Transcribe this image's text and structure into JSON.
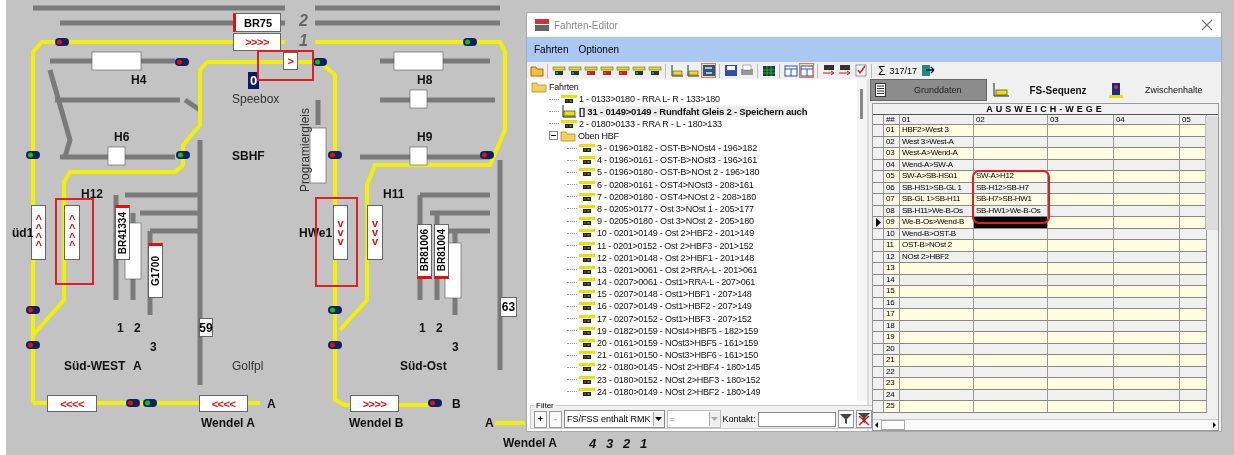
{
  "layout": {
    "labels": [
      {
        "kind": "track_number",
        "text": "2"
      },
      {
        "kind": "track_number",
        "text": "1"
      },
      {
        "kind": "name",
        "text": "H4"
      },
      {
        "kind": "station_box",
        "text": "0"
      },
      {
        "kind": "name",
        "text": "H8"
      },
      {
        "kind": "plain",
        "text": "Speebox"
      },
      {
        "kind": "vertical",
        "text": "Programiergleis"
      },
      {
        "kind": "name",
        "text": "H6"
      },
      {
        "kind": "name",
        "text": "H9"
      },
      {
        "kind": "name",
        "text": "SBHF"
      },
      {
        "kind": "name",
        "text": "H12"
      },
      {
        "kind": "name",
        "text": "H11"
      },
      {
        "kind": "name",
        "text": "üd1"
      },
      {
        "kind": "name",
        "text": "HWe1"
      },
      {
        "kind": "name",
        "text": "1"
      },
      {
        "kind": "name",
        "text": "2"
      },
      {
        "kind": "name",
        "text": "1"
      },
      {
        "kind": "name",
        "text": "2"
      },
      {
        "kind": "name",
        "text": "3"
      },
      {
        "kind": "name",
        "text": "3"
      },
      {
        "kind": "name",
        "text": "Süd-WEST"
      },
      {
        "kind": "name",
        "text": "A"
      },
      {
        "kind": "plain",
        "text": "Golfpl"
      },
      {
        "kind": "name",
        "text": "Süd-Ost"
      },
      {
        "kind": "name",
        "text": "A"
      },
      {
        "kind": "name",
        "text": "B"
      },
      {
        "kind": "name",
        "text": "Wendel  A"
      },
      {
        "kind": "name",
        "text": "Wendel B"
      },
      {
        "kind": "name",
        "text": "A"
      },
      {
        "kind": "name",
        "text": "Wendel A"
      },
      {
        "kind": "italic",
        "text": "4"
      },
      {
        "kind": "italic",
        "text": "3"
      },
      {
        "kind": "italic",
        "text": "2"
      },
      {
        "kind": "italic",
        "text": "1"
      }
    ],
    "blocks": [
      {
        "kind": "train",
        "text": "BR75",
        "edge_left": true
      },
      {
        "kind": "arrows",
        "text": ">>>>"
      },
      {
        "kind": "arrows",
        "text": ">"
      },
      {
        "kind": "arrows_vertical",
        "text": "^^^^"
      },
      {
        "kind": "arrows_vertical",
        "text": "^^^^"
      },
      {
        "kind": "train_vertical",
        "text": "BR41334",
        "edge_top": true
      },
      {
        "kind": "train_vertical",
        "text": "G1700",
        "edge_top": true
      },
      {
        "kind": "arrows_vertical",
        "text": "vvv"
      },
      {
        "kind": "arrows_vertical",
        "text": "vvv"
      },
      {
        "kind": "train_vertical",
        "text": "BR81006",
        "edge_bottom": true
      },
      {
        "kind": "train_vertical",
        "text": "BR81004",
        "edge_bottom": true
      },
      {
        "kind": "counter",
        "text": "63"
      },
      {
        "kind": "counter",
        "text": "59"
      },
      {
        "kind": "arrows",
        "text": "<<<<"
      },
      {
        "kind": "arrows",
        "text": "<<<<"
      },
      {
        "kind": "arrows",
        "text": ">>>>"
      }
    ]
  },
  "window": {
    "title": "Fahrten-Editor"
  },
  "menu": [
    "Fahrten",
    "Optionen"
  ],
  "toolbar": {
    "buttons": [
      {
        "kind": "folder",
        "pressed": false
      },
      {
        "kind": "sep"
      },
      {
        "kind": "loco",
        "pressed": false
      },
      {
        "kind": "loco",
        "pressed": false
      },
      {
        "kind": "loco_red",
        "pressed": false
      },
      {
        "kind": "loco_red",
        "pressed": false
      },
      {
        "kind": "loco_red",
        "pressed": false
      },
      {
        "kind": "loco",
        "pressed": false
      },
      {
        "kind": "loco",
        "pressed": false
      },
      {
        "kind": "sep"
      },
      {
        "kind": "steps",
        "pressed": false
      },
      {
        "kind": "steps",
        "pressed": false
      },
      {
        "kind": "swap",
        "pressed": true
      },
      {
        "kind": "sep"
      },
      {
        "kind": "save",
        "pressed": false
      },
      {
        "kind": "print",
        "pressed": false
      },
      {
        "kind": "sep"
      },
      {
        "kind": "grid",
        "pressed": false
      },
      {
        "kind": "sep"
      },
      {
        "kind": "table",
        "pressed": false
      },
      {
        "kind": "table",
        "pressed": true
      },
      {
        "kind": "sep"
      },
      {
        "kind": "exchange",
        "pressed": false
      },
      {
        "kind": "exchange",
        "pressed": false
      },
      {
        "kind": "check",
        "pressed": false
      },
      {
        "kind": "sep"
      }
    ],
    "sum_symbol": "Σ",
    "count": "317/17"
  },
  "tree": [
    {
      "kind": "folder",
      "label": "Fahrten",
      "children": [
        {
          "kind": "route",
          "label": "1 - 0133>0180 - RRA L- R - 133>180",
          "selected": false
        },
        {
          "kind": "sequence",
          "label": "[] 31 - 0149>0149 - Rundfaht Gleis 2 - Speichern auch",
          "selected": true
        },
        {
          "kind": "route",
          "label": "2 - 0180>0133 - RRA R - L - 180>133",
          "selected": false
        },
        {
          "kind": "folder",
          "label": "Oben HBF",
          "expanded": true,
          "children": [
            {
              "kind": "route",
              "label": "3 - 0196>0182 - OST-B>NOst4 - 196>182",
              "selected": false
            },
            {
              "kind": "route",
              "label": "4 - 0196>0161 - OST-B>NOst3 - 196>161",
              "selected": false
            },
            {
              "kind": "route",
              "label": "5 - 0196>0180 - OST-B>NOst 2 - 196>180",
              "selected": false
            },
            {
              "kind": "route",
              "label": "6 - 0208>0161 - OST4>NOst3 - 208>161",
              "selected": false
            },
            {
              "kind": "route",
              "label": "7 - 0208>0180 - OST4>NOst 2 - 208>180",
              "selected": false
            },
            {
              "kind": "route",
              "label": "8 - 0205>0177 - Ost 3>NOst 1 - 205>177",
              "selected": false
            },
            {
              "kind": "route",
              "label": "9 - 0205>0180 - Ost 3>NOst 2 - 205>180",
              "selected": false
            },
            {
              "kind": "route",
              "label": "10 - 0201>0149 - Ost 2>HBF2 - 201>149",
              "selected": false
            },
            {
              "kind": "route",
              "label": "11 - 0201>0152 - Ost 2>HBF3 - 201>152",
              "selected": false
            },
            {
              "kind": "route",
              "label": "12 - 0201>0148 - Ost 2>HBF1 - 201>148",
              "selected": false
            },
            {
              "kind": "route",
              "label": "13 - 0201>0061 - Ost 2>RRA-L - 201>061",
              "selected": false
            },
            {
              "kind": "route",
              "label": "14 - 0207>0061 - Ost1>RRA-L - 207>061",
              "selected": false
            },
            {
              "kind": "route",
              "label": "15 - 0207>0148 - Ost1>HBF1 - 207>148",
              "selected": false
            },
            {
              "kind": "route",
              "label": "16 - 0207>0149 - Ost1>HBF2 - 207>149",
              "selected": false
            },
            {
              "kind": "route",
              "label": "17 - 0207>0152 - Ost1>HBF3 - 207>152",
              "selected": false
            },
            {
              "kind": "route",
              "label": "19 - 0182>0159 - NOst4>HBF5 - 182>159",
              "selected": false
            },
            {
              "kind": "route",
              "label": "20 - 0161>0159 - NOst3>HBF5 - 161>159",
              "selected": false
            },
            {
              "kind": "route",
              "label": "21 - 0161>0150 - NOst3>HBF6 - 161>150",
              "selected": false
            },
            {
              "kind": "route",
              "label": "22 - 0180>0145 - NOst 2>HBF4 - 180>145",
              "selected": false
            },
            {
              "kind": "route",
              "label": "23 - 0180>0152 - NOst 2>HBF3 - 180>152",
              "selected": false
            },
            {
              "kind": "route",
              "label": "24 - 0180>0149 - NOst 2>HBF2 - 180>149",
              "selected": false
            }
          ]
        }
      ]
    }
  ],
  "filter": {
    "title": "Filter",
    "add": "+",
    "remove": "-",
    "remove_disabled": true,
    "field": "FS/FSS enthält RMK",
    "operator": "=",
    "operator_disabled": true,
    "contact_label": "Kontakt:"
  },
  "tabs": [
    {
      "kind": "list",
      "label": "Grunddaten",
      "selected": false,
      "pressed": true
    },
    {
      "kind": "steps",
      "label": "FS-Sequenz",
      "selected": true,
      "pressed": false
    },
    {
      "kind": "signal",
      "label": "Zwischenhalte",
      "selected": false,
      "pressed": false
    }
  ],
  "grid": {
    "title": "AUSWEICH-WEGE",
    "columns": [
      "##",
      "01",
      "02",
      "03",
      "04",
      "05"
    ],
    "rows": [
      {
        "cells": [
          "01",
          "HBF2>West 3"
        ],
        "selected": false
      },
      {
        "cells": [
          "02",
          "West 3>West-A"
        ],
        "selected": false
      },
      {
        "cells": [
          "03",
          "West-A>Wend-A"
        ],
        "selected": false
      },
      {
        "cells": [
          "04",
          "Wend-A>SW-A"
        ],
        "selected": false
      },
      {
        "cells": [
          "05",
          "SW-A>SB-HSü1",
          "SW-A>H12"
        ],
        "selected": false
      },
      {
        "cells": [
          "06",
          "SB-HS1>SB-GL 1",
          "SB-H12>SB-H7"
        ],
        "selected": false
      },
      {
        "cells": [
          "07",
          "SB-GL 1>SB-H11",
          "SB-H7>SB-HW1"
        ],
        "selected": false
      },
      {
        "cells": [
          "08",
          "SB-H11>We-B-Os",
          "SB-HW1>We-B-Os"
        ],
        "selected": false
      },
      {
        "cells": [
          "09",
          "We-B-Os>Wend-B"
        ],
        "selected": true
      },
      {
        "cells": [
          "10",
          "Wend-B>OST-B"
        ],
        "selected": false
      },
      {
        "cells": [
          "11",
          "OST-B>NOst 2"
        ],
        "selected": false
      },
      {
        "cells": [
          "12",
          "NOst 2>HBF2"
        ],
        "selected": false
      },
      {
        "cells": [
          "13"
        ],
        "selected": false
      },
      {
        "cells": [
          "14"
        ],
        "selected": false
      },
      {
        "cells": [
          "15"
        ],
        "selected": false
      },
      {
        "cells": [
          "16"
        ],
        "selected": false
      },
      {
        "cells": [
          "17"
        ],
        "selected": false
      },
      {
        "cells": [
          "18"
        ],
        "selected": false
      },
      {
        "cells": [
          "19"
        ],
        "selected": false
      },
      {
        "cells": [
          "20"
        ],
        "selected": false
      },
      {
        "cells": [
          "21"
        ],
        "selected": false
      },
      {
        "cells": [
          "22"
        ],
        "selected": false
      },
      {
        "cells": [
          "23"
        ],
        "selected": false
      },
      {
        "cells": [
          "24"
        ],
        "selected": false
      },
      {
        "cells": [
          "25"
        ],
        "selected": false
      }
    ]
  }
}
